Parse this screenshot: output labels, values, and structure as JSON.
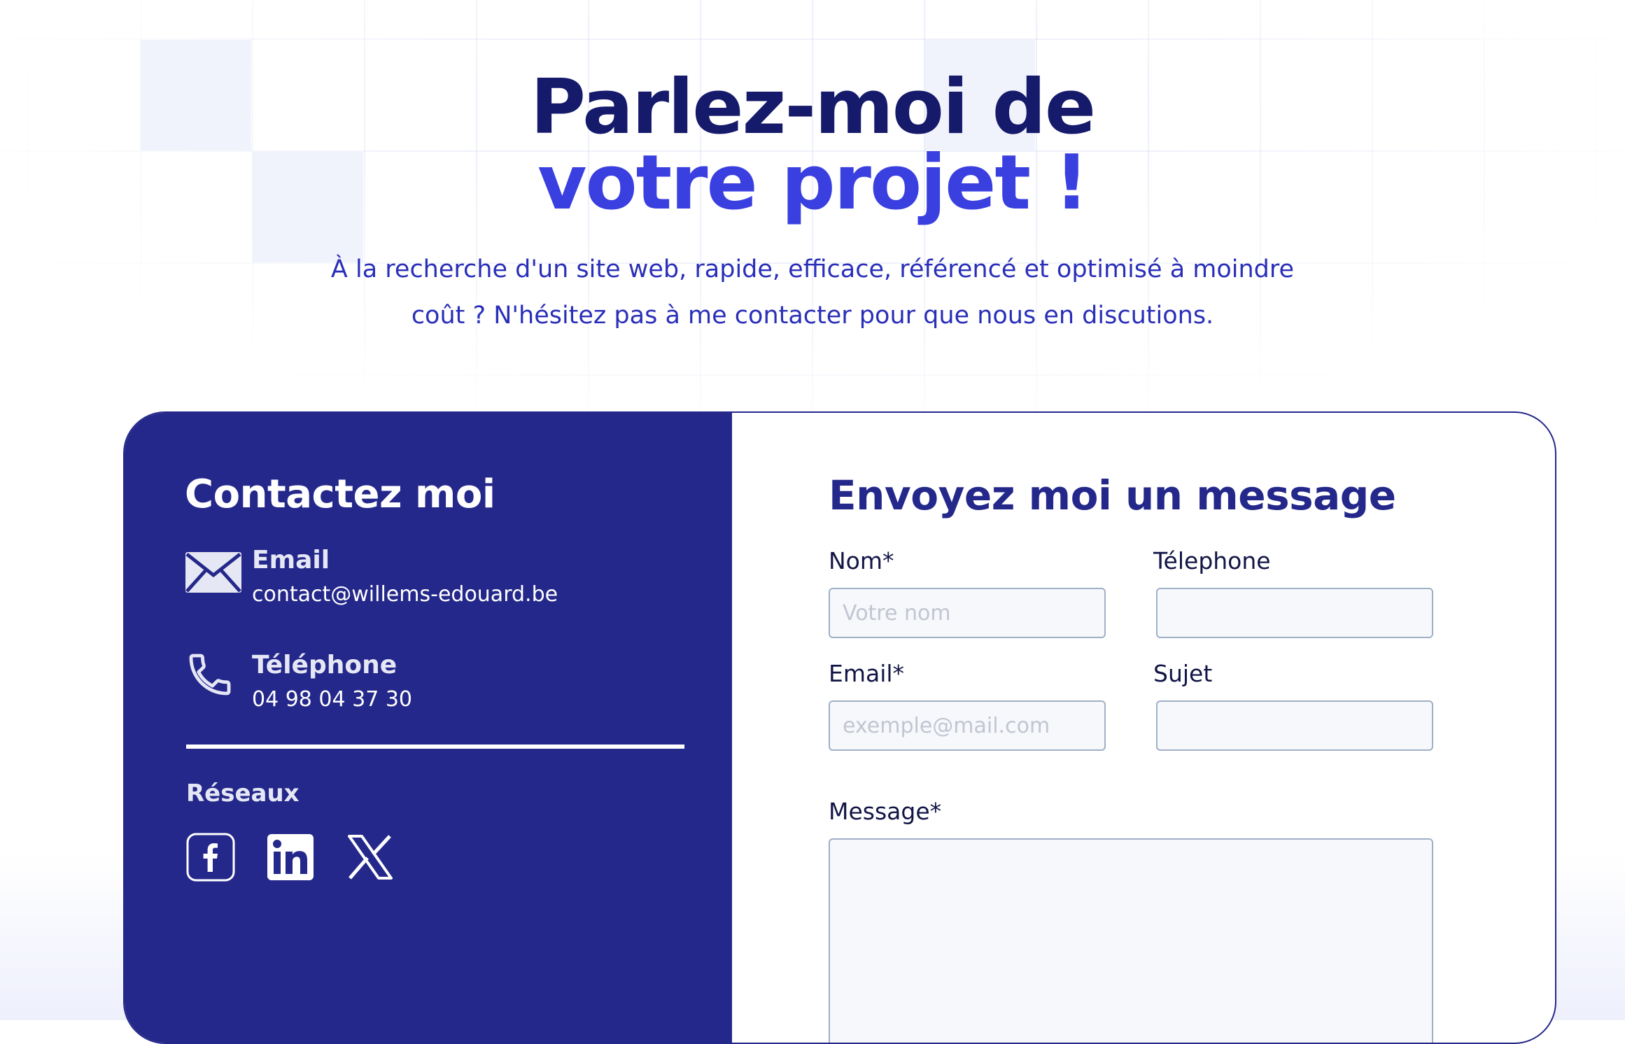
{
  "hero": {
    "title_line1": "Parlez-moi de",
    "title_line2": "votre projet !",
    "subtitle_line1": "À la recherche d'un site web, rapide, efficace, référencé et optimisé à moindre",
    "subtitle_line2": "coût ? N'hésitez pas à me contacter pour que nous en discutions."
  },
  "contact": {
    "title": "Contactez moi",
    "email": {
      "label": "Email",
      "value": "contact@willems-edouard.be",
      "icon": "envelope-icon"
    },
    "phone": {
      "label": "Téléphone",
      "value": "04 98 04 37 30",
      "icon": "phone-icon"
    },
    "networks_label": "Réseaux",
    "networks": [
      {
        "name": "facebook",
        "icon": "facebook-icon"
      },
      {
        "name": "linkedin",
        "icon": "linkedin-icon"
      },
      {
        "name": "x",
        "icon": "x-icon"
      }
    ]
  },
  "form": {
    "title": "Envoyez moi un message",
    "name": {
      "label": "Nom*",
      "placeholder": "Votre nom",
      "value": ""
    },
    "phone": {
      "label": "Télephone",
      "placeholder": "",
      "value": ""
    },
    "email": {
      "label": "Email*",
      "placeholder": "exemple@mail.com",
      "value": ""
    },
    "subject": {
      "label": "Sujet",
      "placeholder": "",
      "value": ""
    },
    "message": {
      "label": "Message*",
      "placeholder": "",
      "value": ""
    }
  },
  "colors": {
    "navy": "#24288a",
    "title_dark": "#161a6b",
    "accent_blue": "#3a3fe0",
    "subtitle_blue": "#2a2fb8",
    "input_border": "#9fb0c8"
  }
}
